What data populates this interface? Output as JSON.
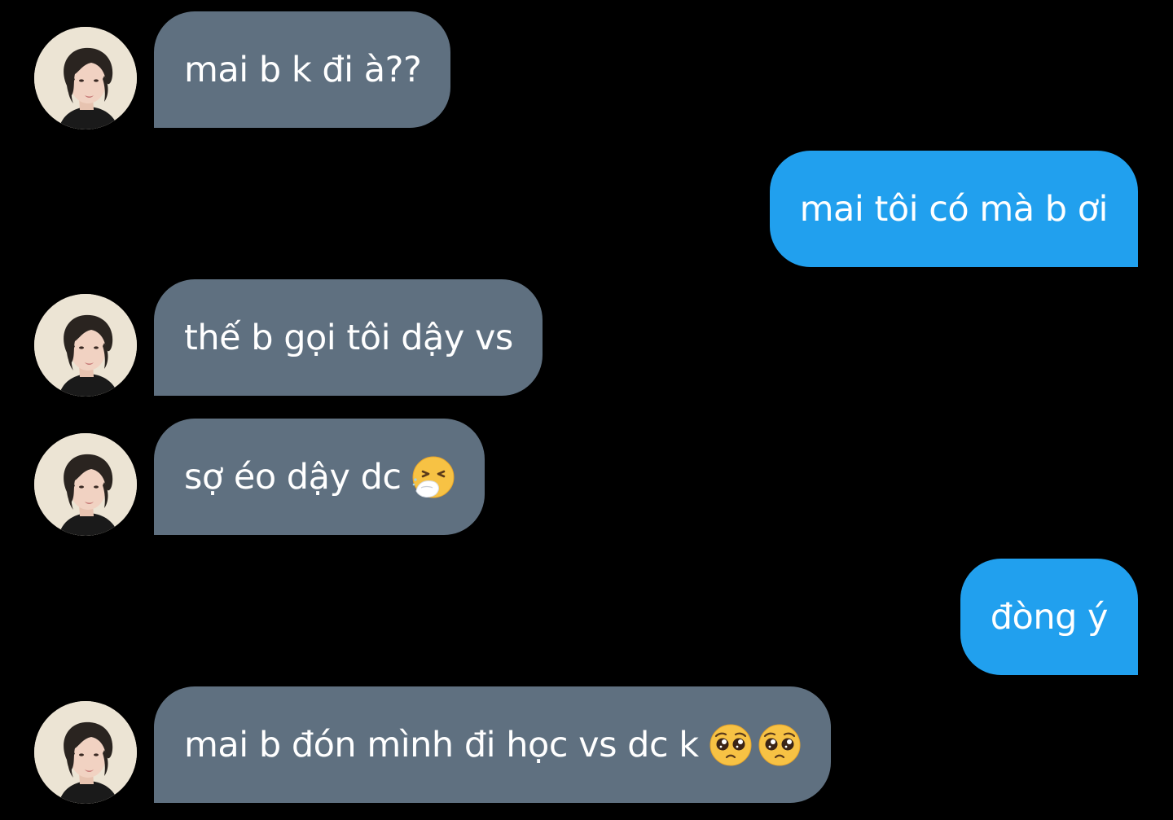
{
  "conversation": {
    "messages": [
      {
        "sender": "them",
        "text": "mai b k đi à??"
      },
      {
        "sender": "me",
        "text": "mai tôi có mà b ơi"
      },
      {
        "sender": "them",
        "text": "thế b gọi tôi dậy vs"
      },
      {
        "sender": "them",
        "text": "sợ éo dậy dc",
        "emojis": [
          "sneezing-face-emoji"
        ]
      },
      {
        "sender": "me",
        "text": "đòng ý"
      },
      {
        "sender": "them",
        "text": "mai b đón mình đi học vs dc k",
        "emojis": [
          "pleading-face-emoji",
          "pleading-face-emoji"
        ]
      }
    ]
  },
  "colors": {
    "background": "#000000",
    "incoming_bubble": "#5f7080",
    "outgoing_bubble": "#21a0ee",
    "text": "#ffffff"
  }
}
